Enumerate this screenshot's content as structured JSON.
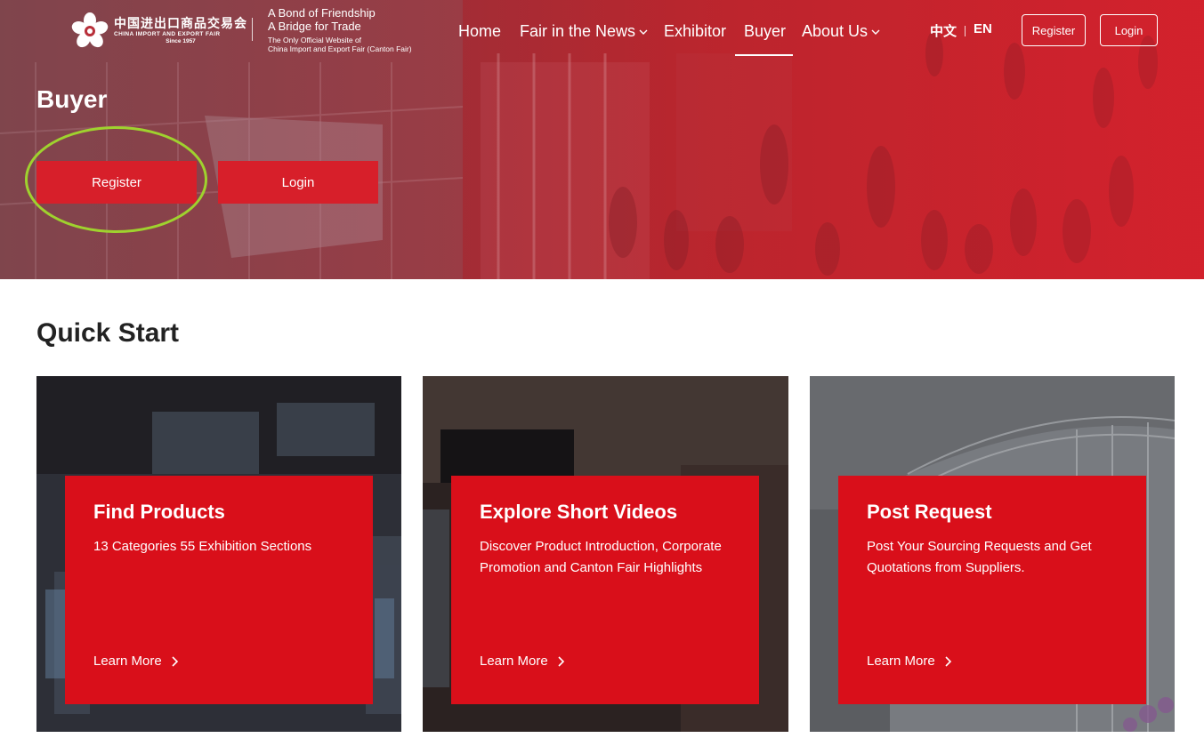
{
  "header": {
    "logo": {
      "cn_name": "中国进出口商品交易会",
      "en_name": "CHINA IMPORT AND EXPORT FAIR",
      "since": "Since 1957"
    },
    "tagline": {
      "line1": "A Bond of Friendship",
      "line2": "A Bridge for Trade",
      "line3": "The Only Official Website of",
      "line4": "China Import and Export Fair (Canton Fair)"
    },
    "nav": [
      {
        "label": "Home",
        "dropdown": false
      },
      {
        "label": "Fair in the News",
        "dropdown": true
      },
      {
        "label": "Exhibitor",
        "dropdown": false
      },
      {
        "label": "Buyer",
        "dropdown": false,
        "active": true
      },
      {
        "label": "About Us",
        "dropdown": true
      }
    ],
    "lang": {
      "cn": "中文",
      "en": "EN"
    },
    "register_label": "Register",
    "login_label": "Login"
  },
  "hero": {
    "title": "Buyer",
    "register_label": "Register",
    "login_label": "Login"
  },
  "quick_start": {
    "title": "Quick Start",
    "cards": [
      {
        "title": "Find Products",
        "description": "13 Categories 55 Exhibition Sections",
        "link": "Learn More"
      },
      {
        "title": "Explore Short Videos",
        "description": "Discover Product Introduction, Corporate Promotion and Canton Fair Highlights",
        "link": "Learn More"
      },
      {
        "title": "Post Request",
        "description": "Post Your Sourcing Requests and Get Quotations from Suppliers.",
        "link": "Learn More"
      }
    ]
  },
  "colors": {
    "brand_red": "#d90f1a",
    "button_red": "#d71f2a",
    "highlight": "#9fd22e"
  }
}
